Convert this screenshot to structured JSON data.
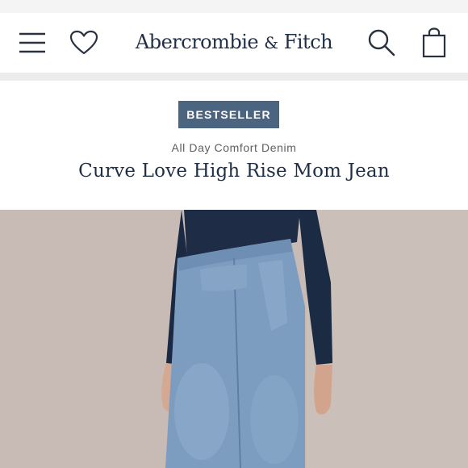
{
  "header": {
    "brand_main": "Abercrombie",
    "brand_amp": "&",
    "brand_end": "Fitch",
    "icons": [
      "menu-icon",
      "heart-icon",
      "search-icon",
      "shopping-bag-icon"
    ]
  },
  "product": {
    "badge": "BESTSELLER",
    "collection": "All Day Comfort Denim",
    "name": "Curve Love High Rise Mom Jean"
  },
  "colors": {
    "brand_navy": "#1f2f45",
    "badge_bg": "#4b6480",
    "photo_bg": "#c9bcb7",
    "denim": "#7d9dc0",
    "top": "#1e2d45"
  }
}
